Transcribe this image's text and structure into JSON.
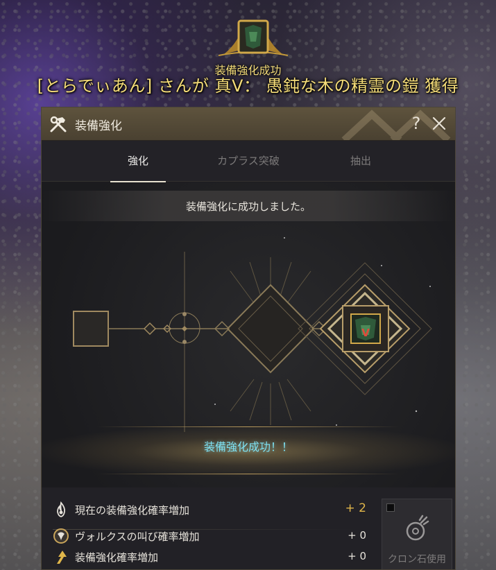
{
  "notification": {
    "small_title": "装備強化成功",
    "main_text": "[とらでぃあん] さんが 真V： 愚鈍な木の精霊の鎧 獲得",
    "emblem_icon": "armor-emblem-icon"
  },
  "window": {
    "title": "装備強化",
    "help": "?",
    "tabs": [
      {
        "label": "強化",
        "active": true
      },
      {
        "label": "カプラス突破",
        "active": false
      },
      {
        "label": "抽出",
        "active": false
      }
    ],
    "result_message": "装備強化に成功しました。",
    "item_grade": "V",
    "success_text": "装備強化成功！！",
    "stats": [
      {
        "label": "現在の装備強化確率増加",
        "value": "+ 2",
        "icon": "flame-icon",
        "highlight": true
      },
      {
        "label": "ヴォルクスの叫び確率増加",
        "value": "+ 0",
        "icon": "vulkus-icon",
        "highlight": false
      },
      {
        "label": "装備強化確率増加",
        "value": "+ 0",
        "icon": "arrow-up-icon",
        "highlight": false
      }
    ],
    "cron": {
      "label": "クロン石使用",
      "checked": false
    }
  },
  "colors": {
    "accent_gold": "#e0b64a",
    "success_cyan": "#7ee0f0",
    "notification_yellow": "#f4dc78"
  }
}
